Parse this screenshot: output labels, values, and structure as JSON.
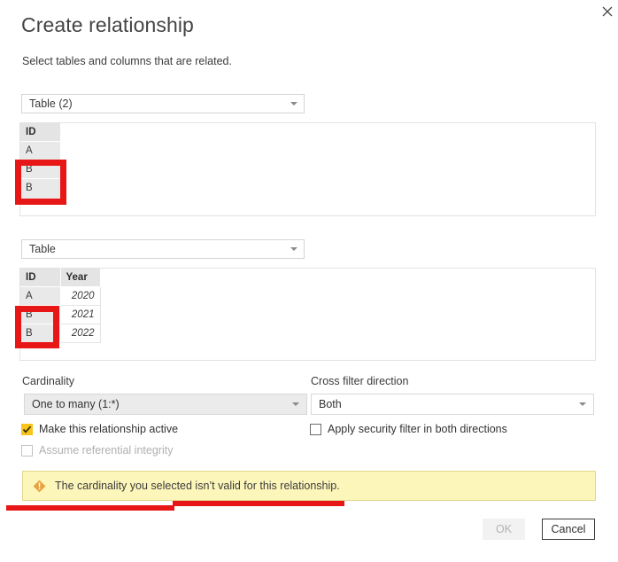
{
  "dialog": {
    "title": "Create relationship",
    "subtitle": "Select tables and columns that are related.",
    "close_icon": "close-icon"
  },
  "tables": {
    "top": {
      "selector_value": "Table (2)",
      "columns": [
        "ID"
      ],
      "rows": [
        [
          "A"
        ],
        [
          "B"
        ],
        [
          "B"
        ]
      ]
    },
    "bottom": {
      "selector_value": "Table",
      "columns": [
        "ID",
        "Year"
      ],
      "rows": [
        [
          "A",
          "2020"
        ],
        [
          "B",
          "2021"
        ],
        [
          "B",
          "2022"
        ]
      ]
    }
  },
  "options": {
    "cardinality_label": "Cardinality",
    "cardinality_value": "One to many (1:*)",
    "crossfilter_label": "Cross filter direction",
    "crossfilter_value": "Both",
    "make_active_label": "Make this relationship active",
    "make_active_checked": true,
    "referential_integrity_label": "Assume referential integrity",
    "referential_integrity_checked": false,
    "security_filter_label": "Apply security filter in both directions",
    "security_filter_checked": false
  },
  "warning": {
    "icon": "warning-diamond-icon",
    "message": "The cardinality you selected isn’t valid for this relationship."
  },
  "footer": {
    "ok_label": "OK",
    "cancel_label": "Cancel"
  },
  "annotations": {
    "color": "#e81717",
    "boxes": 2,
    "underlines": 2
  }
}
